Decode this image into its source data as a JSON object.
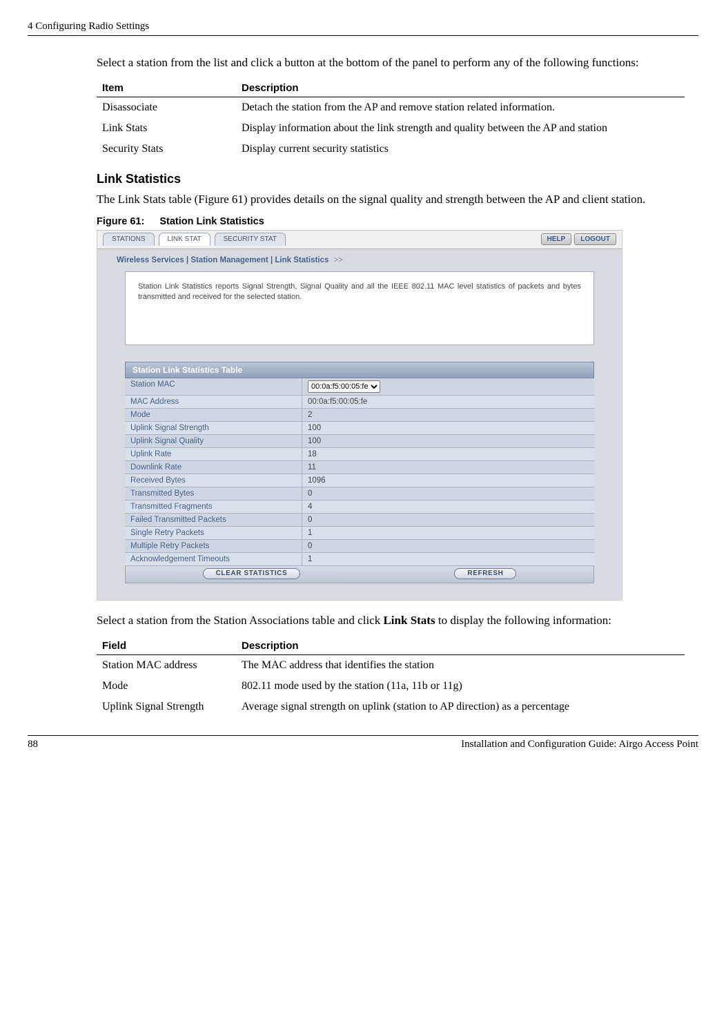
{
  "page_header": "4  Configuring Radio Settings",
  "intro_paragraph": "Select a station from the list and click a button at the bottom of the panel to perform any of the following functions:",
  "item_table": {
    "headers": [
      "Item",
      "Description"
    ],
    "rows": [
      [
        "Disassociate",
        "Detach the station from the AP and remove station related information."
      ],
      [
        "Link Stats",
        "Display information about the link strength and quality between the AP and station"
      ],
      [
        "Security Stats",
        "Display current security statistics"
      ]
    ]
  },
  "subheading": "Link Statistics",
  "link_stats_paragraph": "The Link Stats table (Figure 61) provides details on the signal quality and strength between the AP and client station.",
  "figure_number": "Figure 61:",
  "figure_title": "Station Link Statistics",
  "ui": {
    "tabs": [
      "STATIONS",
      "LINK STAT",
      "SECURITY STAT"
    ],
    "active_tab_index": 1,
    "help_label": "HELP",
    "logout_label": "LOGOUT",
    "breadcrumb": "Wireless Services | Station Management | Link Statistics",
    "breadcrumb_arrow": ">>",
    "desc_box": "Station Link Statistics reports Signal Strength, Signal Quality and all the IEEE 802.11 MAC level statistics of packets and bytes transmitted and received for the selected station.",
    "stats_title": "Station Link Statistics Table",
    "stats_rows": [
      {
        "label": "Station MAC",
        "value": "00:0a:f5:00:05:fe",
        "is_select": true
      },
      {
        "label": "MAC Address",
        "value": "00:0a:f5:00:05:fe"
      },
      {
        "label": "Mode",
        "value": "2"
      },
      {
        "label": "Uplink Signal Strength",
        "value": "100"
      },
      {
        "label": "Uplink Signal Quality",
        "value": "100"
      },
      {
        "label": "Uplink Rate",
        "value": "18"
      },
      {
        "label": "Downlink Rate",
        "value": "11"
      },
      {
        "label": "Received Bytes",
        "value": "1096"
      },
      {
        "label": "Transmitted Bytes",
        "value": "0"
      },
      {
        "label": "Transmitted Fragments",
        "value": "4"
      },
      {
        "label": "Failed Transmitted Packets",
        "value": "0"
      },
      {
        "label": "Single Retry Packets",
        "value": "1"
      },
      {
        "label": "Multiple Retry Packets",
        "value": "0"
      },
      {
        "label": "Acknowledgement Timeouts",
        "value": "1"
      }
    ],
    "clear_btn": "CLEAR STATISTICS",
    "refresh_btn": "REFRESH"
  },
  "after_figure_text_1": "Select a station from the Station Associations table and click ",
  "after_figure_bold": "Link Stats",
  "after_figure_text_2": " to display the following information:",
  "field_table": {
    "headers": [
      "Field",
      "Description"
    ],
    "rows": [
      [
        "Station MAC address",
        "The MAC address that identifies the station"
      ],
      [
        "Mode",
        " 802.11 mode used by the station (11a, 11b or 11g)"
      ],
      [
        "Uplink Signal Strength",
        "Average signal strength on uplink (station to AP direction) as a percentage"
      ]
    ]
  },
  "footer_left": "88",
  "footer_right": "Installation and Configuration Guide: Airgo Access Point"
}
